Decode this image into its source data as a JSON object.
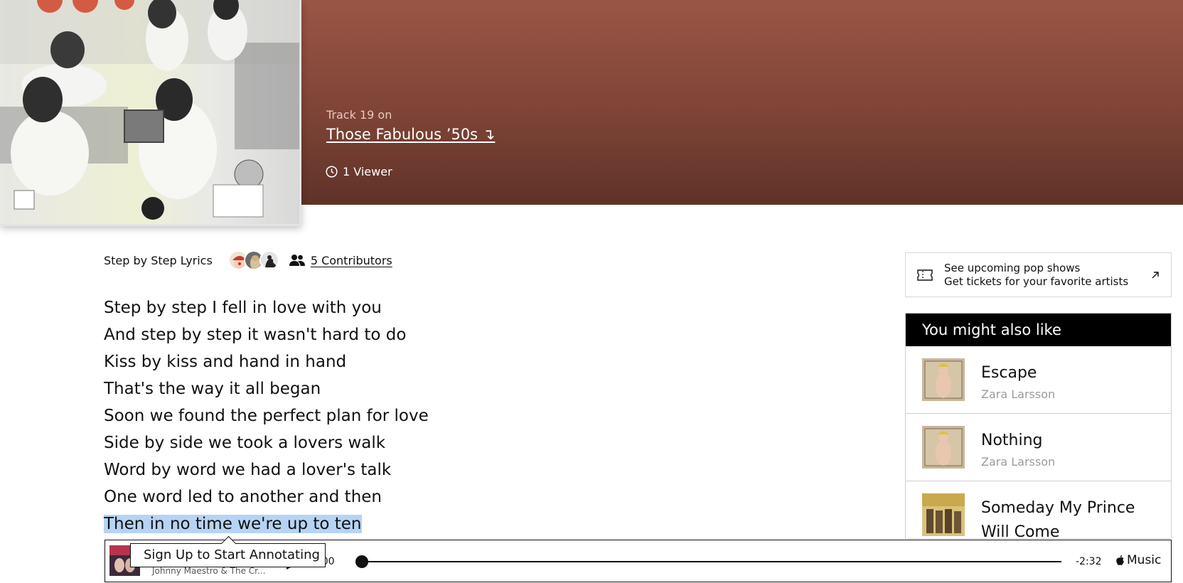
{
  "header": {
    "track_label": "Track 19 on",
    "album_link": "Those Fabulous ’50s ↴",
    "viewers": "1 Viewer"
  },
  "meta": {
    "lyrics_title": "Step by Step Lyrics",
    "contributors": "5 Contributors"
  },
  "lyrics": [
    "Step by step I fell in love with you",
    "And step by step it wasn't hard to do",
    "Kiss by kiss and hand in hand",
    "That's the way it all began",
    "Soon we found the perfect plan for love",
    "Side by side we took a lovers walk",
    "Word by word we had a lover's talk",
    "One word led to another and then",
    "Then in no time we're up to ten"
  ],
  "highlighted_line_index": 8,
  "tickets": {
    "line1": "See upcoming pop shows",
    "line2": "Get tickets for your favorite artists"
  },
  "also_like": {
    "heading": "You might also like",
    "songs": [
      {
        "title": "Escape",
        "artist": "Zara Larsson"
      },
      {
        "title": "Nothing",
        "artist": "Zara Larsson"
      },
      {
        "title": "Someday My Prince Will Come",
        "artist": ""
      }
    ]
  },
  "player": {
    "artist": "Johnny Maestro & The Cr...",
    "elapsed": ":00",
    "remaining": "-2:32",
    "brand": "Music"
  },
  "tooltip": "Sign Up to Start Annotating",
  "colors": {
    "header_top": "#9a5546",
    "header_bottom": "#5f3228",
    "highlight": "#b7d3f4"
  }
}
